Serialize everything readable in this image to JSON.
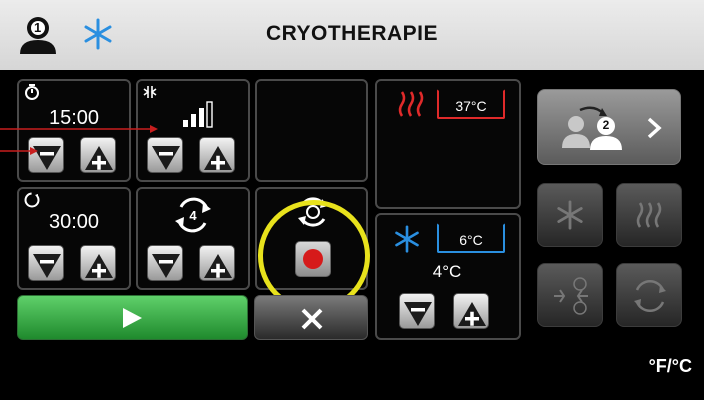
{
  "header": {
    "title": "CRYOTHERAPIE",
    "profile_number": "1",
    "icons": [
      "person-1-icon",
      "snowflake-icon"
    ]
  },
  "timer_panel": {
    "value": "15:00",
    "icon": "timer-icon"
  },
  "intensity_panel": {
    "icon": "pressure-icon",
    "level_icon": "signal-bars-icon"
  },
  "cycle_timer_panel": {
    "value": "30:00",
    "icon": "cycle-timer-icon"
  },
  "cycles_panel": {
    "count": "4",
    "icon": "repeat-icon"
  },
  "alternate_panel": {
    "icon": "alternate-mode-icon",
    "record_icon": "record-icon"
  },
  "hot_panel": {
    "temperature": "37°C",
    "icon": "heat-waves-icon",
    "color": "#e02a2a"
  },
  "cold_panel": {
    "temperature": "6°C",
    "setpoint": "4°C",
    "icon": "snowflake-icon",
    "color": "#2a8fe0"
  },
  "right_controls": {
    "next_patient_number": "2",
    "icons": [
      "person-switch-icon",
      "snowflake-icon",
      "heat-waves-icon",
      "combined-mode-icon",
      "cycle-mode-icon"
    ]
  },
  "units_label": "°F/°C",
  "colors": {
    "start": "#2fa83a",
    "highlight": "#e8e21c",
    "hot": "#e02a2a",
    "cold": "#2a8fe0"
  }
}
